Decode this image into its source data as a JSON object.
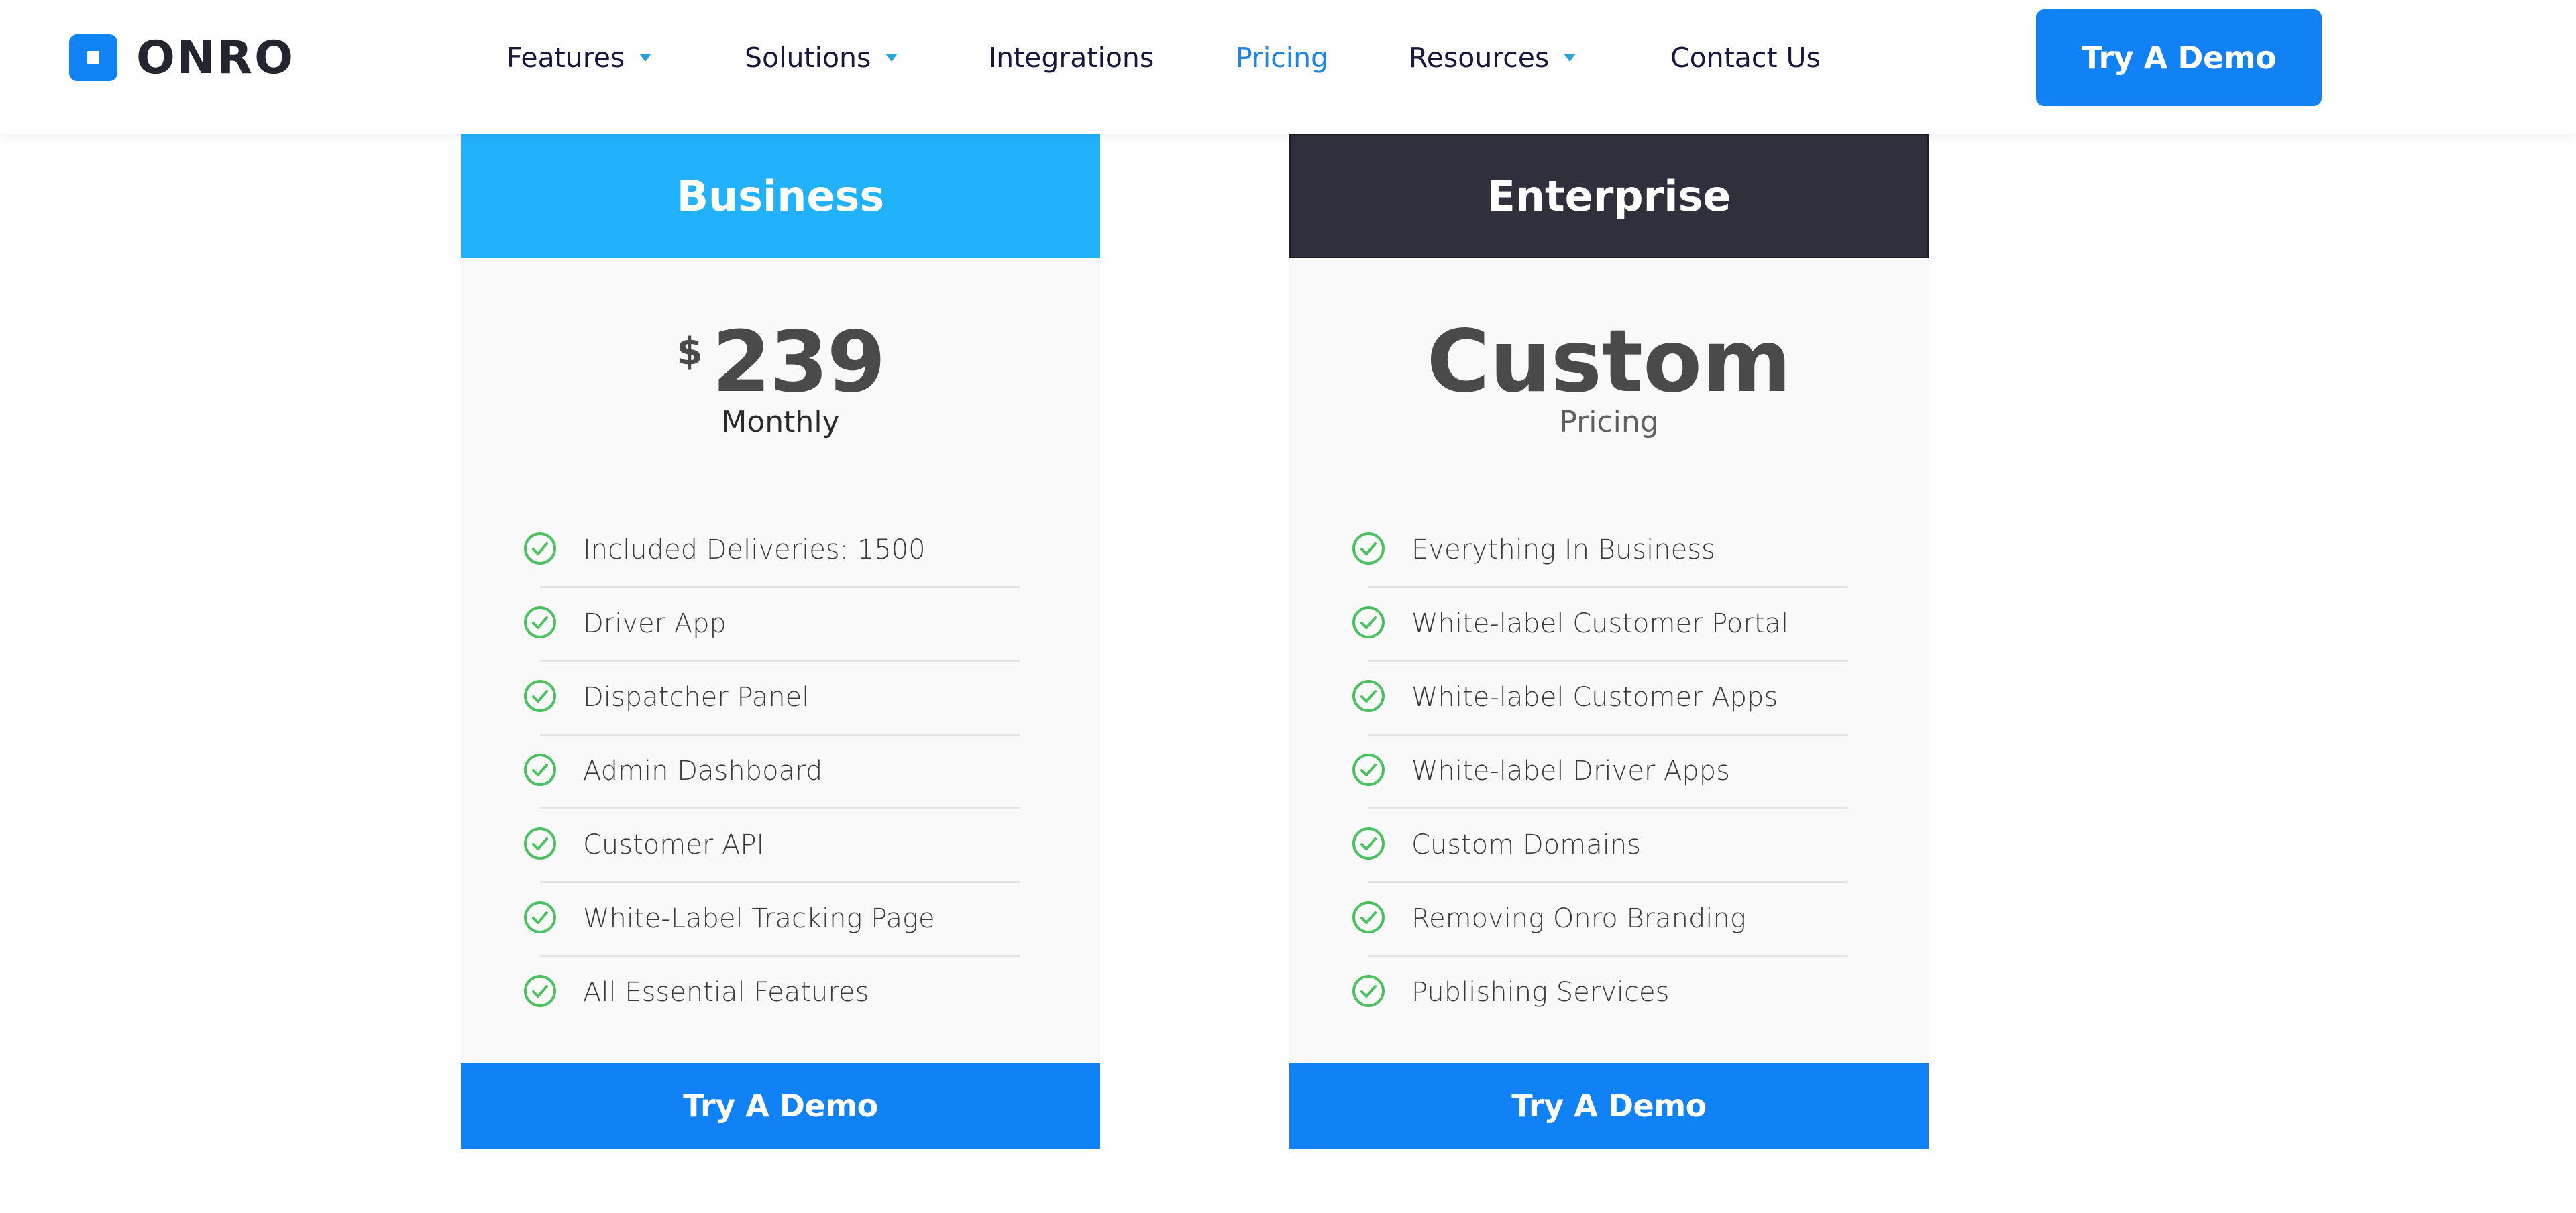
{
  "brand": {
    "name": "ONRO",
    "accent": "#1182f6"
  },
  "nav": {
    "items": [
      {
        "label": "Features",
        "has_dropdown": true,
        "active": false
      },
      {
        "label": "Solutions",
        "has_dropdown": true,
        "active": false
      },
      {
        "label": "Integrations",
        "has_dropdown": false,
        "active": false
      },
      {
        "label": "Pricing",
        "has_dropdown": false,
        "active": true
      },
      {
        "label": "Resources",
        "has_dropdown": true,
        "active": false
      },
      {
        "label": "Contact Us",
        "has_dropdown": false,
        "active": false
      }
    ],
    "cta_label": "Try A Demo"
  },
  "plans": [
    {
      "name": "Business",
      "header_color": "#22b1fb",
      "currency": "$",
      "price": "239",
      "period": "Monthly",
      "features": [
        "Included Deliveries: 1500",
        "Driver App",
        "Dispatcher Panel",
        "Admin Dashboard",
        "Customer API",
        "White-Label Tracking Page",
        "All Essential Features"
      ],
      "cta_label": "Try A Demo"
    },
    {
      "name": "Enterprise",
      "header_color": "#302f3c",
      "currency": "",
      "price": "Custom",
      "period": "Pricing",
      "features": [
        "Everything In Business",
        "White-label Customer Portal",
        "White-label Customer Apps",
        "White-label Driver Apps",
        "Custom Domains",
        "Removing Onro Branding",
        "Publishing Services"
      ],
      "cta_label": "Try A Demo"
    }
  ],
  "icons": {
    "feature_check": "check-circle-icon",
    "check_color": "#4cc160"
  }
}
